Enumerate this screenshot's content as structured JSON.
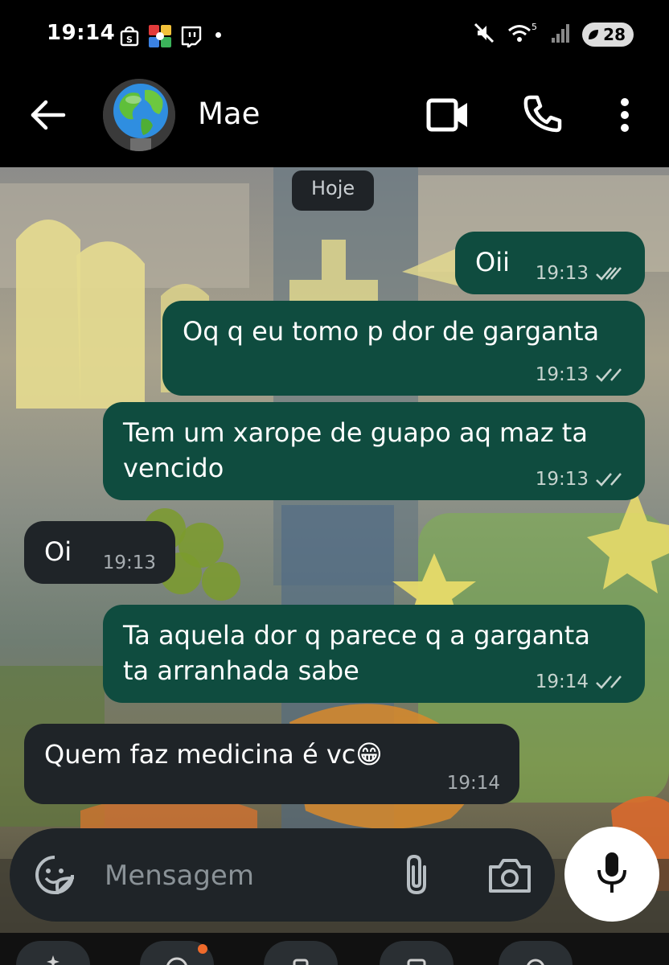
{
  "status_bar": {
    "time": "19:14",
    "battery": "28",
    "left_icons": [
      "shopee-icon",
      "colorful-app-icon",
      "twitch-icon",
      "notification-dot"
    ],
    "right_icons": [
      "mute-icon",
      "wifi-5g-icon",
      "signal-icon",
      "battery-icon"
    ]
  },
  "header": {
    "contact_name": "Mae",
    "avatar": "globe-avatar",
    "actions": [
      "back-arrow-icon",
      "video-call-icon",
      "phone-call-icon",
      "menu-dots-icon"
    ]
  },
  "chat": {
    "date_chip": "Hoje",
    "messages": [
      {
        "direction": "out",
        "lines": [
          "Oii"
        ],
        "time": "19:13",
        "status": "read"
      },
      {
        "direction": "out",
        "lines": [
          "Oq q eu tomo p dor de garganta"
        ],
        "time": "19:13",
        "status": "read"
      },
      {
        "direction": "out",
        "lines": [
          "Tem um xarope de guapo aq maz ta",
          "vencido"
        ],
        "time": "19:13",
        "status": "read"
      },
      {
        "direction": "in",
        "lines": [
          "Oi"
        ],
        "time": "19:13"
      },
      {
        "direction": "out",
        "lines": [
          "Ta aquela dor q parece q a garganta",
          "ta arranhada sabe"
        ],
        "time": "19:14",
        "status": "read"
      },
      {
        "direction": "in",
        "lines": [
          "Quem faz medicina é vc"
        ],
        "emoji": "😁",
        "time": "19:14"
      }
    ]
  },
  "composer": {
    "placeholder": "Mensagem",
    "icons": [
      "emoji-sticker-icon",
      "attach-icon",
      "camera-icon",
      "mic-icon"
    ]
  },
  "colors": {
    "outgoing_bubble": "#0f4c3f",
    "incoming_bubble": "#1f2428",
    "header_bg": "#000000",
    "badge": "#ef6a2b"
  }
}
